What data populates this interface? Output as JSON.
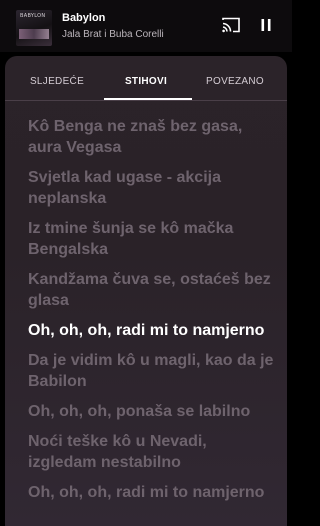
{
  "player": {
    "album_art_text": "BABYLON",
    "title": "Babylon",
    "artist": "Jala Brat i Buba Corelli",
    "cast_icon": "cast-icon",
    "pause_icon": "pause-icon"
  },
  "tabs": [
    {
      "label": "SLJEDEĆE",
      "active": false
    },
    {
      "label": "STIHOVI",
      "active": true
    },
    {
      "label": "POVEZANO",
      "active": false
    }
  ],
  "lyrics": [
    {
      "text": "Kô Benga ne znaš bez gasa, aura Vegasa",
      "current": false
    },
    {
      "text": "Svjetla kad ugase - akcija neplanska",
      "current": false
    },
    {
      "text": "Iz tmine šunja se kô mačka Bengalska",
      "current": false
    },
    {
      "text": "Kandžama čuva se, ostaćeš bez glasa",
      "current": false
    },
    {
      "text": "Oh, oh, oh, radi mi to namjerno",
      "current": true
    },
    {
      "text": "Da je vidim kô u magli, kao da je Babilon",
      "current": false
    },
    {
      "text": "Oh, oh, oh, ponaša se labilno",
      "current": false
    },
    {
      "text": "Noći teške kô u Nevadi, izgledam nestabilno",
      "current": false
    },
    {
      "text": "Oh, oh, oh, radi mi to namjerno",
      "current": false
    }
  ]
}
